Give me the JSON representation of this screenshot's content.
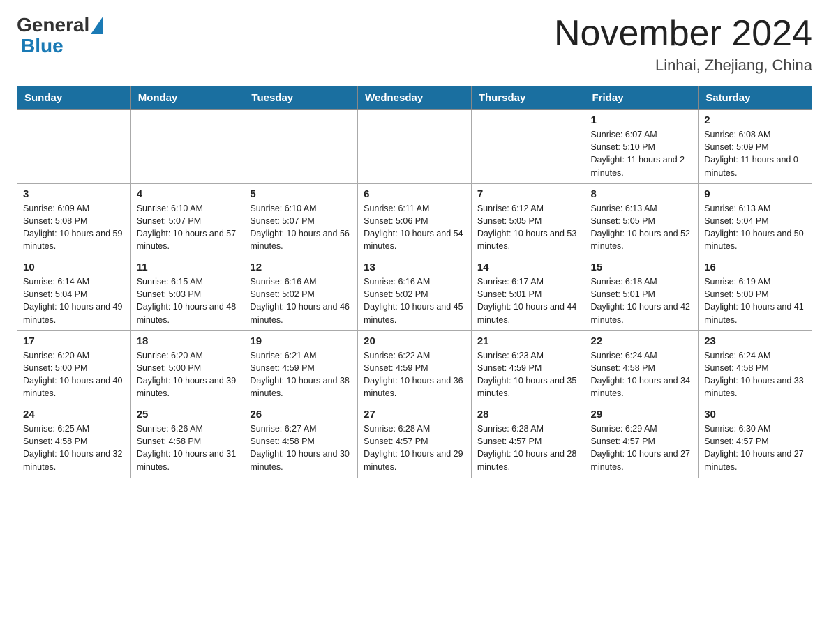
{
  "logo": {
    "general": "General",
    "blue": "Blue"
  },
  "title": "November 2024",
  "location": "Linhai, Zhejiang, China",
  "days_of_week": [
    "Sunday",
    "Monday",
    "Tuesday",
    "Wednesday",
    "Thursday",
    "Friday",
    "Saturday"
  ],
  "weeks": [
    [
      {
        "day": "",
        "info": ""
      },
      {
        "day": "",
        "info": ""
      },
      {
        "day": "",
        "info": ""
      },
      {
        "day": "",
        "info": ""
      },
      {
        "day": "",
        "info": ""
      },
      {
        "day": "1",
        "info": "Sunrise: 6:07 AM\nSunset: 5:10 PM\nDaylight: 11 hours and 2 minutes."
      },
      {
        "day": "2",
        "info": "Sunrise: 6:08 AM\nSunset: 5:09 PM\nDaylight: 11 hours and 0 minutes."
      }
    ],
    [
      {
        "day": "3",
        "info": "Sunrise: 6:09 AM\nSunset: 5:08 PM\nDaylight: 10 hours and 59 minutes."
      },
      {
        "day": "4",
        "info": "Sunrise: 6:10 AM\nSunset: 5:07 PM\nDaylight: 10 hours and 57 minutes."
      },
      {
        "day": "5",
        "info": "Sunrise: 6:10 AM\nSunset: 5:07 PM\nDaylight: 10 hours and 56 minutes."
      },
      {
        "day": "6",
        "info": "Sunrise: 6:11 AM\nSunset: 5:06 PM\nDaylight: 10 hours and 54 minutes."
      },
      {
        "day": "7",
        "info": "Sunrise: 6:12 AM\nSunset: 5:05 PM\nDaylight: 10 hours and 53 minutes."
      },
      {
        "day": "8",
        "info": "Sunrise: 6:13 AM\nSunset: 5:05 PM\nDaylight: 10 hours and 52 minutes."
      },
      {
        "day": "9",
        "info": "Sunrise: 6:13 AM\nSunset: 5:04 PM\nDaylight: 10 hours and 50 minutes."
      }
    ],
    [
      {
        "day": "10",
        "info": "Sunrise: 6:14 AM\nSunset: 5:04 PM\nDaylight: 10 hours and 49 minutes."
      },
      {
        "day": "11",
        "info": "Sunrise: 6:15 AM\nSunset: 5:03 PM\nDaylight: 10 hours and 48 minutes."
      },
      {
        "day": "12",
        "info": "Sunrise: 6:16 AM\nSunset: 5:02 PM\nDaylight: 10 hours and 46 minutes."
      },
      {
        "day": "13",
        "info": "Sunrise: 6:16 AM\nSunset: 5:02 PM\nDaylight: 10 hours and 45 minutes."
      },
      {
        "day": "14",
        "info": "Sunrise: 6:17 AM\nSunset: 5:01 PM\nDaylight: 10 hours and 44 minutes."
      },
      {
        "day": "15",
        "info": "Sunrise: 6:18 AM\nSunset: 5:01 PM\nDaylight: 10 hours and 42 minutes."
      },
      {
        "day": "16",
        "info": "Sunrise: 6:19 AM\nSunset: 5:00 PM\nDaylight: 10 hours and 41 minutes."
      }
    ],
    [
      {
        "day": "17",
        "info": "Sunrise: 6:20 AM\nSunset: 5:00 PM\nDaylight: 10 hours and 40 minutes."
      },
      {
        "day": "18",
        "info": "Sunrise: 6:20 AM\nSunset: 5:00 PM\nDaylight: 10 hours and 39 minutes."
      },
      {
        "day": "19",
        "info": "Sunrise: 6:21 AM\nSunset: 4:59 PM\nDaylight: 10 hours and 38 minutes."
      },
      {
        "day": "20",
        "info": "Sunrise: 6:22 AM\nSunset: 4:59 PM\nDaylight: 10 hours and 36 minutes."
      },
      {
        "day": "21",
        "info": "Sunrise: 6:23 AM\nSunset: 4:59 PM\nDaylight: 10 hours and 35 minutes."
      },
      {
        "day": "22",
        "info": "Sunrise: 6:24 AM\nSunset: 4:58 PM\nDaylight: 10 hours and 34 minutes."
      },
      {
        "day": "23",
        "info": "Sunrise: 6:24 AM\nSunset: 4:58 PM\nDaylight: 10 hours and 33 minutes."
      }
    ],
    [
      {
        "day": "24",
        "info": "Sunrise: 6:25 AM\nSunset: 4:58 PM\nDaylight: 10 hours and 32 minutes."
      },
      {
        "day": "25",
        "info": "Sunrise: 6:26 AM\nSunset: 4:58 PM\nDaylight: 10 hours and 31 minutes."
      },
      {
        "day": "26",
        "info": "Sunrise: 6:27 AM\nSunset: 4:58 PM\nDaylight: 10 hours and 30 minutes."
      },
      {
        "day": "27",
        "info": "Sunrise: 6:28 AM\nSunset: 4:57 PM\nDaylight: 10 hours and 29 minutes."
      },
      {
        "day": "28",
        "info": "Sunrise: 6:28 AM\nSunset: 4:57 PM\nDaylight: 10 hours and 28 minutes."
      },
      {
        "day": "29",
        "info": "Sunrise: 6:29 AM\nSunset: 4:57 PM\nDaylight: 10 hours and 27 minutes."
      },
      {
        "day": "30",
        "info": "Sunrise: 6:30 AM\nSunset: 4:57 PM\nDaylight: 10 hours and 27 minutes."
      }
    ]
  ]
}
